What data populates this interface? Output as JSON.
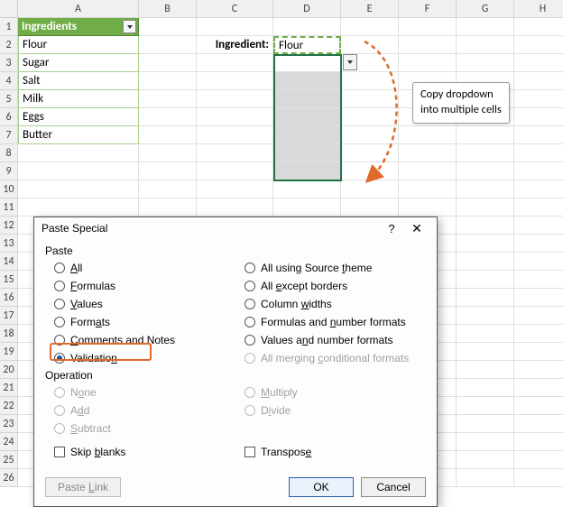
{
  "columns": [
    "A",
    "B",
    "C",
    "D",
    "E",
    "F",
    "G",
    "H"
  ],
  "rows": [
    "1",
    "2",
    "3",
    "4",
    "5",
    "6",
    "7",
    "8",
    "9",
    "10",
    "11",
    "12",
    "13",
    "14",
    "15",
    "16",
    "17",
    "18",
    "19",
    "20",
    "21",
    "22",
    "23",
    "24",
    "25",
    "26"
  ],
  "table": {
    "header": "Ingredients",
    "items": [
      "Flour",
      "Sugar",
      "Salt",
      "Milk",
      "Eggs",
      "Butter"
    ]
  },
  "label_c2": "Ingredient:",
  "d2_value": "Flour",
  "callout": {
    "line1": "Copy dropdown",
    "line2": "into multiple cells"
  },
  "dialog": {
    "title": "Paste Special",
    "help": "?",
    "close": "✕",
    "section_paste": "Paste",
    "paste_left": [
      "All",
      "Formulas",
      "Values",
      "Formats",
      "Comments and Notes",
      "Validation"
    ],
    "paste_right": [
      "All using Source theme",
      "All except borders",
      "Column widths",
      "Formulas and number formats",
      "Values and number formats",
      "All merging conditional formats"
    ],
    "paste_selected": "Validation",
    "paste_right_disabled": [
      "All merging conditional formats"
    ],
    "section_operation": "Operation",
    "op_left": [
      "None",
      "Add",
      "Subtract"
    ],
    "op_right": [
      "Multiply",
      "Divide"
    ],
    "skip_blanks": "Skip blanks",
    "transpose": "Transpose",
    "paste_link": "Paste Link",
    "ok": "OK",
    "cancel": "Cancel"
  },
  "underline_map": {
    "All": 0,
    "Formulas": 0,
    "Values": 0,
    "Formats": 4,
    "Comments and Notes": 0,
    "Validation": 9,
    "All using Source theme": 17,
    "All except borders": 4,
    "Column widths": 7,
    "Formulas and number formats": 13,
    "Values and number formats": 8,
    "All merging conditional formats": 12,
    "None": 1,
    "Add": 1,
    "Subtract": 0,
    "Multiply": 0,
    "Divide": 1,
    "Skip blanks": 5,
    "Transpose": 8,
    "Paste Link": 6
  }
}
